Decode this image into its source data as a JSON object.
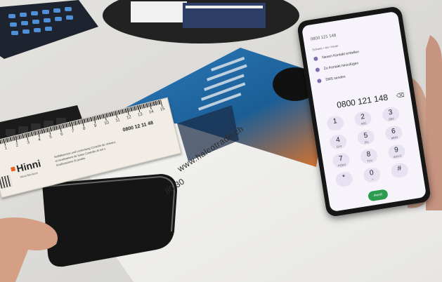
{
  "phone": {
    "contact_label": "0800 121 148",
    "contact_sub": "Schweiz • bis • heute",
    "menu": [
      {
        "label": "Neuen Kontakt erstellen",
        "icon": "person-add-icon"
      },
      {
        "label": "Zu Kontakt hinzufügen",
        "icon": "contacts-icon"
      },
      {
        "label": "SMS senden",
        "icon": "message-icon"
      }
    ],
    "dialed": "0800 121 148",
    "keys": [
      {
        "d": "1",
        "l": ""
      },
      {
        "d": "2",
        "l": "ABC"
      },
      {
        "d": "3",
        "l": "DEF"
      },
      {
        "d": "4",
        "l": "GHI"
      },
      {
        "d": "5",
        "l": "JKL"
      },
      {
        "d": "6",
        "l": "MNO"
      },
      {
        "d": "7",
        "l": "PQRS"
      },
      {
        "d": "8",
        "l": "TUV"
      },
      {
        "d": "9",
        "l": "WXYZ"
      },
      {
        "d": "*",
        "l": ""
      },
      {
        "d": "0",
        "l": "+"
      },
      {
        "d": "#",
        "l": ""
      }
    ],
    "call_label": "Anruf"
  },
  "ruler": {
    "brand": "Hinni",
    "brand_sub": "Hinni Services",
    "phone": "0800 12 11 48",
    "numbers": [
      "1",
      "2",
      "3",
      "4",
      "5",
      "6",
      "7",
      "8",
      "9",
      "10",
      "11",
      "12",
      "13",
      "14",
      "15"
    ],
    "small_text": "Notfallservice und Leckortung Contrôle de réseaux et localisations de fuites Controllo di reti e localizzazione di perdite"
  },
  "flyer": {
    "url": "www.halcotrade.ch",
    "number": "80 30"
  }
}
